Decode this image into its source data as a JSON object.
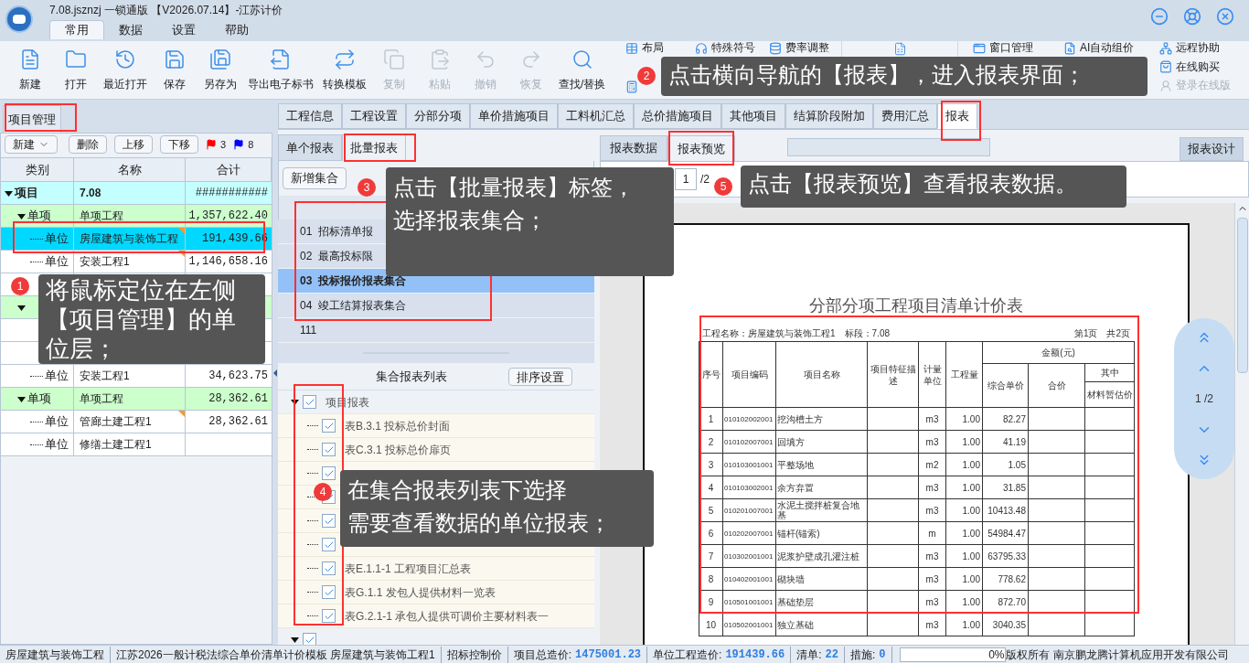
{
  "window": {
    "title": "7.08.jsznzj 一锁通版 【V2026.07.14】-江苏计价"
  },
  "menu_tabs": [
    {
      "label": "常用",
      "selected": true
    },
    {
      "label": "数据",
      "selected": false
    },
    {
      "label": "设置",
      "selected": false
    },
    {
      "label": "帮助",
      "selected": false
    }
  ],
  "toolbar": {
    "large_buttons": [
      {
        "label": "新建",
        "disabled": false
      },
      {
        "label": "打开",
        "disabled": false
      },
      {
        "label": "最近打开",
        "disabled": false
      },
      {
        "label": "保存",
        "disabled": false
      },
      {
        "label": "另存为",
        "disabled": false
      },
      {
        "label": "导出电子标书",
        "disabled": false
      },
      {
        "label": "转换模板",
        "disabled": false
      },
      {
        "label": "复制",
        "disabled": true
      },
      {
        "label": "粘贴",
        "disabled": true
      },
      {
        "label": "撤销",
        "disabled": true
      },
      {
        "label": "恢复",
        "disabled": true
      },
      {
        "label": "查找/替换",
        "disabled": false
      }
    ],
    "group_1": [
      [
        {
          "label": "布局",
          "disabled": false
        }
      ],
      [
        {
          "label": "特殊符号",
          "disabled": false
        }
      ],
      [
        {
          "label": "费率调整",
          "disabled": false
        }
      ]
    ],
    "group_2": [
      [
        {
          "label": "窗口管理",
          "disabled": false
        }
      ],
      [
        {
          "label": "AI自动组价",
          "disabled": false
        }
      ],
      [
        {
          "label": "远程协助",
          "disabled": false
        },
        {
          "label": "在线购买",
          "disabled": false
        },
        {
          "label": "登录在线版",
          "disabled": true
        }
      ]
    ]
  },
  "project_panel": {
    "tab": "项目管理",
    "buttons": [
      "新建",
      "删除",
      "上移",
      "下移"
    ],
    "flags": [
      {
        "color": "#ff0000",
        "count": "3"
      },
      {
        "color": "#0000ff",
        "count": "8"
      }
    ],
    "columns": [
      "类别",
      "名称",
      "合计"
    ],
    "tree": [
      {
        "kind": "project",
        "category": "项目",
        "name": "7.08",
        "total": "###########",
        "selected": false,
        "expanded": true,
        "children": [
          {
            "kind": "item",
            "category": "单项",
            "name": "单项工程",
            "total": "1,357,622.40",
            "selected": false,
            "expanded": true,
            "children": [
              {
                "kind": "unit",
                "category": "单位",
                "name": "房屋建筑与装饰工程",
                "total": "191,439.66",
                "selected": true,
                "marked": true
              },
              {
                "kind": "unit",
                "category": "单位",
                "name": "安装工程1",
                "total": "1,146,658.16",
                "selected": false,
                "marked": true
              },
              {
                "kind": "unit",
                "selected": false,
                "marked": false
              }
            ]
          },
          {
            "kind": "item",
            "selected": false,
            "expanded": true,
            "children": [
              {
                "kind": "unit",
                "selected": false,
                "marked": false
              },
              {
                "kind": "unit",
                "selected": false,
                "marked": false
              },
              {
                "kind": "unit",
                "category": "单位",
                "name": "安装工程1",
                "total": "34,623.75",
                "selected": false,
                "marked": false
              }
            ]
          },
          {
            "kind": "item",
            "category": "单项",
            "name": "单项工程",
            "total": "28,362.61",
            "selected": false,
            "expanded": true,
            "children": [
              {
                "kind": "unit",
                "category": "单位",
                "name": "管廊土建工程1",
                "total": "28,362.61",
                "selected": false,
                "marked": true
              },
              {
                "kind": "unit",
                "category": "单位",
                "name": "修缮土建工程1",
                "selected": false,
                "marked": false
              }
            ]
          }
        ]
      }
    ]
  },
  "top_tabs": [
    {
      "label": "工程信息",
      "selected": false
    },
    {
      "label": "工程设置",
      "selected": false
    },
    {
      "label": "分部分项",
      "selected": false
    },
    {
      "label": "单价措施项目",
      "selected": false
    },
    {
      "label": "工料机汇总",
      "selected": false
    },
    {
      "label": "总价措施项目",
      "selected": false
    },
    {
      "label": "其他项目",
      "selected": false
    },
    {
      "label": "结算阶段附加",
      "selected": false
    },
    {
      "label": "费用汇总",
      "selected": false
    },
    {
      "label": "报表",
      "selected": true
    }
  ],
  "report_panel": {
    "tabs": [
      {
        "label": "单个报表",
        "selected": false
      },
      {
        "label": "批量报表",
        "selected": true
      }
    ],
    "add_button": "新增集合",
    "collections": [
      {
        "code": "01",
        "name": "招标清单报",
        "selected": false
      },
      {
        "code": "02",
        "name": "最高投标限",
        "selected": false
      },
      {
        "code": "03",
        "name": "投标报价报表集合",
        "selected": true
      },
      {
        "code": "04",
        "name": "竣工结算报表集合",
        "selected": false
      },
      {
        "name": "111",
        "selected": false
      }
    ],
    "list_title": "集合报表列表",
    "sort_button": "排序设置",
    "report_tree": [
      {
        "label": "项目报表",
        "checked": true,
        "expanded": true,
        "children": [
          {
            "label": "表B.3.1 投标总价封面",
            "checked": true
          },
          {
            "label": "表C.3.1 投标总价扉页",
            "checked": true
          },
          {
            "checked": true
          },
          {
            "checked": true
          },
          {
            "checked": true
          },
          {
            "checked": true
          },
          {
            "label": "表E.1.1-1 工程项目汇总表",
            "checked": true
          },
          {
            "label": "表G.1.1 发包人提供材料一览表",
            "checked": true
          },
          {
            "label": "表G.2.1-1 承包人提供可调价主要材料表一",
            "checked": true
          }
        ]
      },
      {
        "checked": true,
        "expanded": true
      }
    ]
  },
  "preview_panel": {
    "tabs": [
      {
        "label": "报表数据",
        "selected": false
      },
      {
        "label": "报表预览",
        "selected": true
      }
    ],
    "design_button": "报表设计",
    "page": "1",
    "page_total": "/2",
    "report": {
      "title": "分部分项工程项目清单计价表",
      "info_left": "工程名称：房屋建筑与装饰工程1　标段：7.08",
      "info_right": "第1页　共2页",
      "columns": [
        "序号",
        "项目编码",
        "项目名称",
        "项目特征描述",
        "计量单位",
        "工程量"
      ],
      "amount_header": "金额(元)",
      "amount_columns": [
        "综合单价",
        "合价"
      ],
      "of_which": "其中",
      "of_which_column": "材料暂估价",
      "rows": [
        [
          "1",
          "010102002001",
          "挖沟槽土方",
          "",
          "m3",
          "1.00",
          "82.27",
          "",
          ""
        ],
        [
          "2",
          "010102007001",
          "回填方",
          "",
          "m3",
          "1.00",
          "41.19",
          "",
          ""
        ],
        [
          "3",
          "010103001001",
          "平整场地",
          "",
          "m2",
          "1.00",
          "1.05",
          "",
          ""
        ],
        [
          "4",
          "010103002001",
          "余方弃置",
          "",
          "m3",
          "1.00",
          "31.85",
          "",
          ""
        ],
        [
          "5",
          "010201007001",
          "水泥土搅拌桩复合地基",
          "",
          "m3",
          "1.00",
          "10413.48",
          "",
          ""
        ],
        [
          "6",
          "010202007001",
          "锚杆(锚索)",
          "",
          "m",
          "1.00",
          "54984.47",
          "",
          ""
        ],
        [
          "7",
          "010302001001",
          "泥浆护壁成孔灌注桩",
          "",
          "m3",
          "1.00",
          "63795.33",
          "",
          ""
        ],
        [
          "8",
          "010402001001",
          "砌块墙",
          "",
          "m3",
          "1.00",
          "778.62",
          "",
          ""
        ],
        [
          "9",
          "010501001001",
          "基础垫层",
          "",
          "m3",
          "1.00",
          "872.70",
          "",
          ""
        ],
        [
          "10",
          "010502001001",
          "独立基础",
          "",
          "m3",
          "1.00",
          "3040.35",
          "",
          ""
        ]
      ]
    },
    "page_nav": "1 /2"
  },
  "callouts": [
    {
      "number": "1",
      "lines": [
        "将鼠标定位在左侧",
        "【项目管理】的单",
        "位层；"
      ]
    },
    {
      "number": "2",
      "lines": [
        "点击横向导航的【报表】，进入报表界面；"
      ]
    },
    {
      "number": "3",
      "lines": [
        "点击【批量报表】标签，",
        "选择报表集合；"
      ]
    },
    {
      "number": "4",
      "lines": [
        "在集合报表列表下选择",
        "需要查看数据的单位报表；"
      ]
    },
    {
      "number": "5",
      "lines": [
        "点击【报表预览】查看报表数据。"
      ]
    }
  ],
  "status_bar": {
    "items": [
      {
        "kind": "text",
        "label": "房屋建筑与装饰工程"
      },
      {
        "kind": "text",
        "label": "江苏2026一般计税法综合单价清单计价模板 房屋建筑与装饰工程1"
      },
      {
        "kind": "text",
        "label": "招标控制价"
      },
      {
        "kind": "pair",
        "label": "项目总造价:",
        "value": "1475001.23"
      },
      {
        "kind": "pair",
        "label": "单位工程造价:",
        "value": "191439.66"
      },
      {
        "kind": "pair",
        "label": "清单:",
        "value": "22"
      },
      {
        "kind": "pair",
        "label": "措施:",
        "value": "0"
      }
    ],
    "progress": {
      "level": 0,
      "reading": "0%"
    },
    "copyright": "版权所有",
    "company": "南京鹏龙腾计算机应用开发有限公司"
  }
}
